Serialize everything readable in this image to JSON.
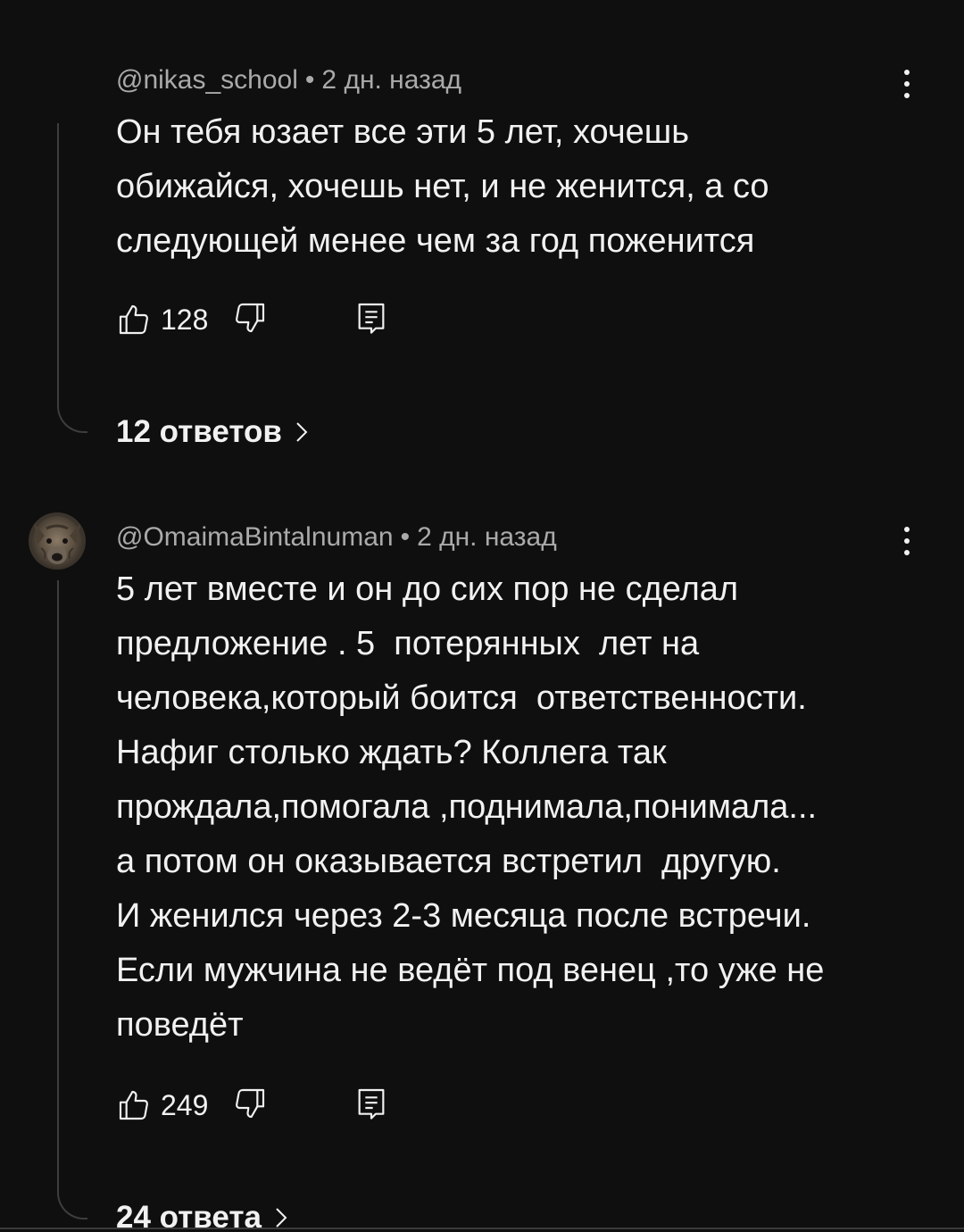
{
  "comments": [
    {
      "author": "@nikas_school",
      "separator": "•",
      "time": "2 дн. назад",
      "text_lines": [
        "Он тебя юзает все эти 5 лет, хочешь",
        "обижайся, хочешь нет, и не женится, а со",
        "следующей менее чем за год поженится"
      ],
      "likes": "128",
      "replies": "12 ответов",
      "has_avatar": false
    },
    {
      "author": "@OmaimaBintalnuman",
      "separator": "•",
      "time": "2 дн. назад",
      "text_lines": [
        "5 лет вместе и он до сих пор не сделал",
        "предложение . 5  потерянных  лет на",
        "человека,который боится  ответственности.",
        "Нафиг столько ждать? Коллега так",
        "прождала,помогала ,поднимала,понимала...",
        "а потом он оказывается встретил  другую.",
        "И женился через 2-3 месяца после встречи.",
        "Если мужчина не ведёт под венец ,то уже не",
        "поведёт"
      ],
      "likes": "249",
      "replies": "24 ответа",
      "has_avatar": true
    }
  ],
  "icons": {
    "like": "thumb-up-icon",
    "dislike": "thumb-down-icon",
    "reply": "reply-comment-icon",
    "menu": "more-vert-icon",
    "chevron": "chevron-right-icon"
  },
  "colors": {
    "background": "#0f0f0f",
    "text": "#f1f1f1",
    "meta": "#aaaaaa",
    "thread_line": "#3d3d3d"
  }
}
